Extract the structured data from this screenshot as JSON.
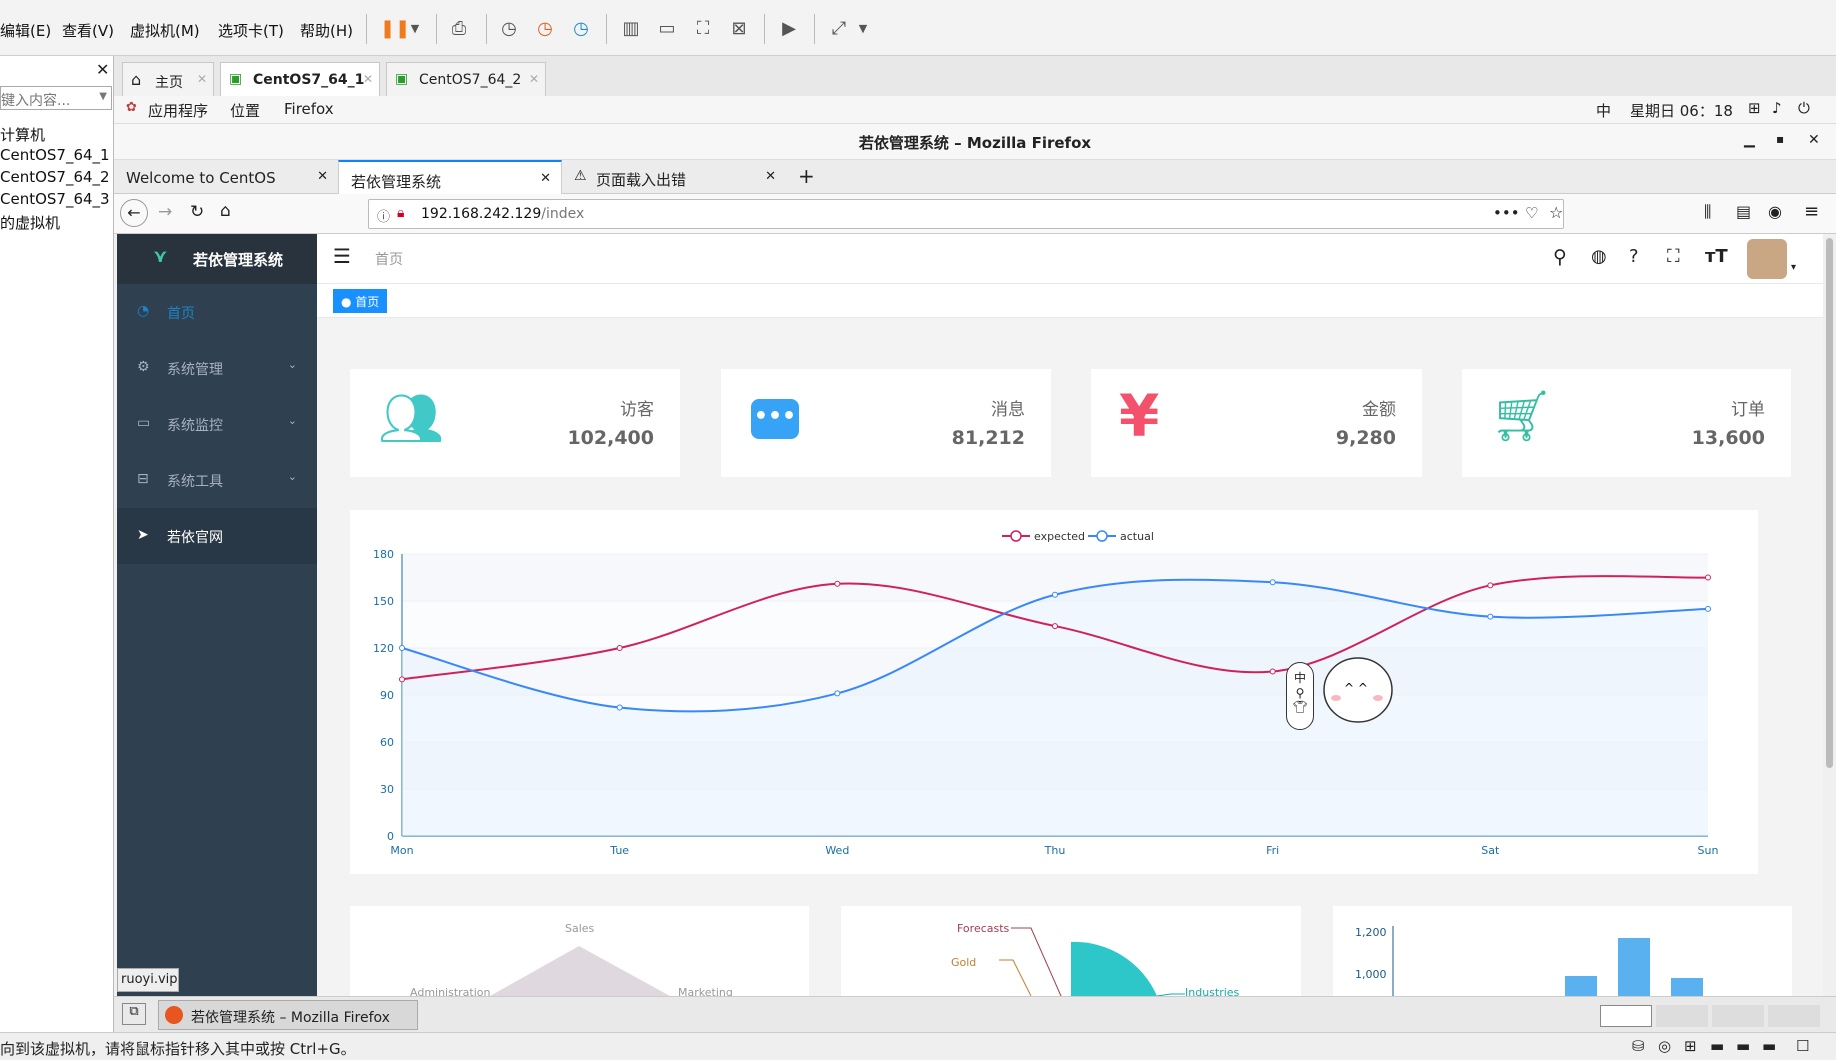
{
  "vm_menu": {
    "items": [
      "编辑(E)",
      "查看(V)",
      "虚拟机(M)",
      "选项卡(T)",
      "帮助(H)"
    ]
  },
  "library": {
    "search_placeholder": "键入内容...",
    "items": [
      "计算机",
      "CentOS7_64_1",
      "CentOS7_64_2",
      "CentOS7_64_3",
      "的虚拟机"
    ]
  },
  "vm_tabs": [
    "主页",
    "CentOS7_64_1",
    "CentOS7_64_2"
  ],
  "gnome_bar": {
    "apps": "应用程序",
    "places": "位置",
    "firefox": "Firefox",
    "ime": "中",
    "clock": "星期日 06：18"
  },
  "firefox": {
    "window_title": "若依管理系统 – Mozilla Firefox",
    "tabs": [
      "Welcome to CentOS",
      "若依管理系统",
      "页面载入出错"
    ],
    "url_host": "192.168.242.129",
    "url_path": "/index"
  },
  "app": {
    "logo_text": "若依管理系统",
    "sidebar": [
      {
        "label": "首页",
        "icon": "dashboard-icon"
      },
      {
        "label": "系统管理",
        "icon": "gear-icon"
      },
      {
        "label": "系统监控",
        "icon": "monitor-icon"
      },
      {
        "label": "系统工具",
        "icon": "toolbox-icon"
      },
      {
        "label": "若依官网",
        "icon": "send-icon"
      }
    ],
    "breadcrumb": "首页",
    "active_tag": "首页",
    "stats": [
      {
        "label": "访客",
        "value": "102,400",
        "icon": "users-icon",
        "color": "#40c9c6"
      },
      {
        "label": "消息",
        "value": "81,212",
        "icon": "message-icon",
        "color": "#36a3f7"
      },
      {
        "label": "金额",
        "value": "9,280",
        "icon": "yen-icon",
        "color": "#f4516c"
      },
      {
        "label": "订单",
        "value": "13,600",
        "icon": "cart-icon",
        "color": "#34bfa3"
      }
    ],
    "radar_labels": [
      "Sales",
      "Administration",
      "Marketing"
    ],
    "pie_labels": [
      "Forecasts",
      "Gold",
      "Industries"
    ],
    "bar_ticks": [
      "1,200",
      "1,000"
    ],
    "status_link": "ruoyi.vip",
    "mascot_ime": "中"
  },
  "chart_data": {
    "type": "line",
    "categories": [
      "Mon",
      "Tue",
      "Wed",
      "Thu",
      "Fri",
      "Sat",
      "Sun"
    ],
    "series": [
      {
        "name": "expected",
        "values": [
          100,
          120,
          161,
          134,
          105,
          160,
          165
        ],
        "color": "#d0215a"
      },
      {
        "name": "actual",
        "values": [
          120,
          82,
          91,
          154,
          162,
          140,
          145
        ],
        "color": "#3888fa"
      }
    ],
    "ylim": [
      0,
      180
    ],
    "yticks": [
      0,
      30,
      60,
      90,
      120,
      150,
      180
    ],
    "legend": "top-center",
    "grid": true
  },
  "taskbar": {
    "window_label": "若依管理系统 – Mozilla Firefox"
  },
  "status_bar": {
    "text": "向到该虚拟机，请将鼠标指针移入其中或按 Ctrl+G。"
  }
}
